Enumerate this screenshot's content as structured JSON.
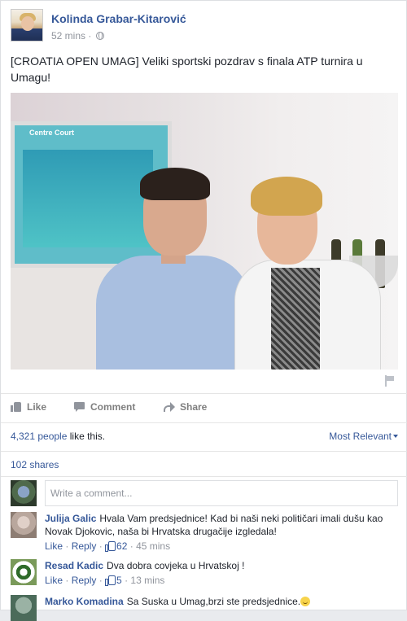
{
  "post": {
    "author": "Kolinda Grabar-Kitarović",
    "time": "52 mins",
    "separator": " · ",
    "text": "[CROATIA OPEN UMAG] Veliki sportski pozdrav s finala ATP turnira u Umagu!",
    "photo_tv_label": "Centre Court"
  },
  "actions": {
    "like": "Like",
    "comment": "Comment",
    "share": "Share"
  },
  "stats": {
    "likes_count": "4,321 people",
    "likes_rest": " like this.",
    "relevance": "Most Relevant",
    "shares": "102 shares"
  },
  "composer": {
    "placeholder": "Write a comment..."
  },
  "comments": [
    {
      "author": "Julija Galic",
      "text": "Hvala Vam predsjednice! Kad bi naši neki političari imali dušu kao Novak Djokovic, naša bi Hrvatska drugačije izgledala!",
      "like": "Like",
      "reply": "Reply",
      "likes": "62",
      "time": "45 mins"
    },
    {
      "author": "Resad Kadic",
      "text": "Dva dobra covjeka u Hrvatskoj !",
      "like": "Like",
      "reply": "Reply",
      "likes": "5",
      "time": "13 mins"
    },
    {
      "author": "Marko Komadina",
      "text": "Sa Suska u Umag,brzi ste predsjednice."
    }
  ],
  "icons": [
    "globe-icon",
    "flag-icon",
    "like-icon",
    "comment-icon",
    "share-icon",
    "caret-down-icon",
    "smile-emoji-icon"
  ],
  "colors": {
    "link": "#365899",
    "meta": "#90949c",
    "text": "#1d2129"
  }
}
